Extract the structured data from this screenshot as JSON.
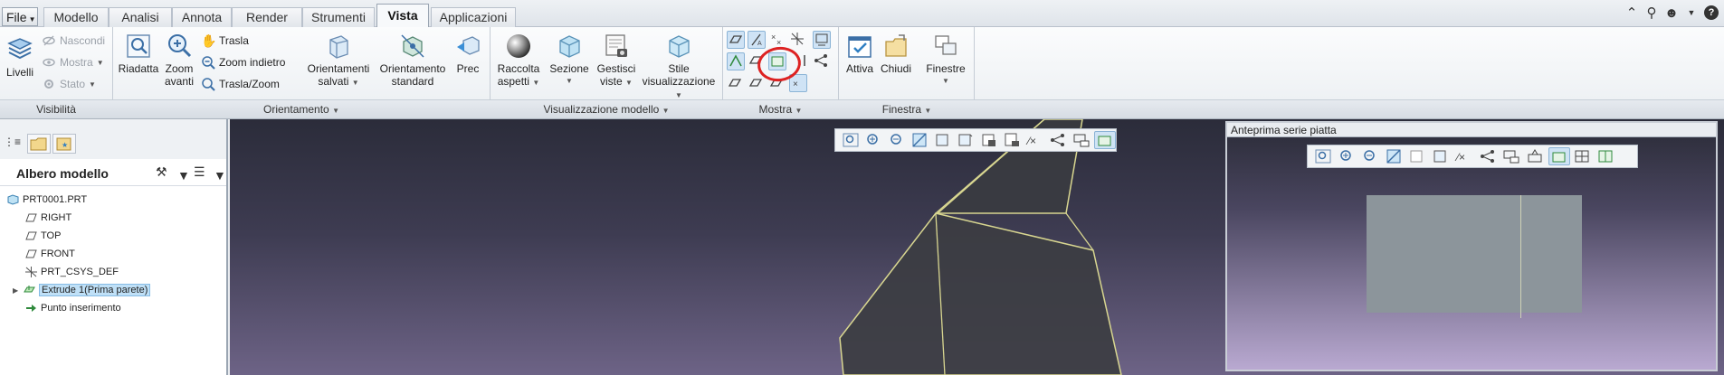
{
  "tabs": {
    "file": "File",
    "items": [
      "Modello",
      "Analisi",
      "Annota",
      "Render",
      "Strumenti",
      "Vista",
      "Applicazioni"
    ],
    "active": "Vista"
  },
  "ribbon": {
    "visibilita": {
      "label": "Visibilità",
      "livelli": "Livelli",
      "nascondi": "Nascondi",
      "mostra": "Mostra",
      "stato": "Stato"
    },
    "orientamento": {
      "label": "Orientamento",
      "riadatta": "Riadatta",
      "zoom_avanti_1": "Zoom",
      "zoom_avanti_2": "avanti",
      "trasla": "Trasla",
      "zoom_indietro": "Zoom indietro",
      "trasla_zoom": "Trasla/Zoom",
      "orient_salvati_1": "Orientamenti",
      "orient_salvati_2": "salvati",
      "orient_standard_1": "Orientamento",
      "orient_standard_2": "standard",
      "prec": "Prec"
    },
    "visualizzazione": {
      "label": "Visualizzazione modello",
      "raccolta_1": "Raccolta",
      "raccolta_2": "aspetti",
      "sezione": "Sezione",
      "gestisci_1": "Gestisci",
      "gestisci_2": "viste",
      "stile_1": "Stile",
      "stile_2": "visualizzazione"
    },
    "mostra": {
      "label": "Mostra"
    },
    "finestra": {
      "label": "Finestra",
      "attiva": "Attiva",
      "chiudi": "Chiudi",
      "finestre": "Finestre"
    }
  },
  "tree": {
    "title": "Albero modello",
    "items": [
      {
        "label": "PRT0001.PRT",
        "icon": "part-icon"
      },
      {
        "label": "RIGHT",
        "icon": "datum-plane-icon"
      },
      {
        "label": "TOP",
        "icon": "datum-plane-icon"
      },
      {
        "label": "FRONT",
        "icon": "datum-plane-icon"
      },
      {
        "label": "PRT_CSYS_DEF",
        "icon": "csys-icon"
      },
      {
        "label": "Extrude 1(Prima parete)",
        "icon": "extrude-icon"
      },
      {
        "label": "Punto inserimento",
        "icon": "insert-arrow-icon"
      }
    ]
  },
  "preview": {
    "title": "Anteprima serie piatta"
  },
  "colors": {
    "accent": "#2f7fc2",
    "highlight_circle": "#dd2222",
    "model_edge": "#e8e6a0",
    "selection": "#bfe0f7"
  }
}
